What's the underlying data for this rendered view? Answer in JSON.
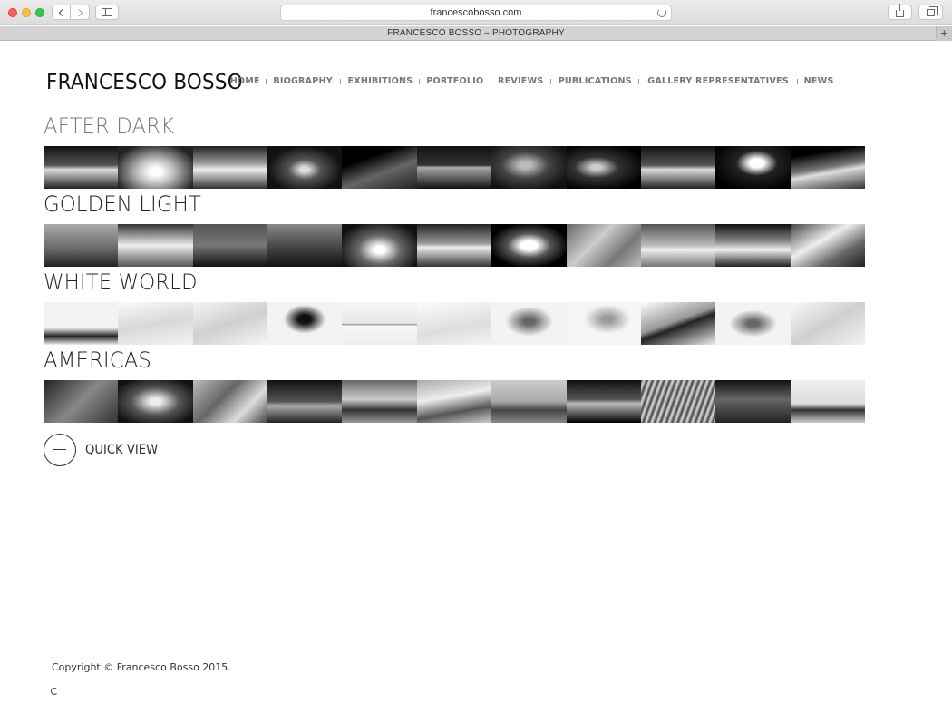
{
  "browser": {
    "url": "francescobosso.com",
    "tab_title": "FRANCESCO BOSSO – PHOTOGRAPHY",
    "new_tab_label": "+"
  },
  "site": {
    "brand": "FRANCESCO BOSSO",
    "nav": [
      {
        "label": "HOME"
      },
      {
        "label": "BIOGRAPHY"
      },
      {
        "label": "EXHIBITIONS"
      },
      {
        "label": "PORTFOLIO"
      },
      {
        "label": "REVIEWS"
      },
      {
        "label": "PUBLICATIONS"
      },
      {
        "label": "GALLERY REPRESENTATIVES"
      },
      {
        "label": "NEWS"
      }
    ]
  },
  "galleries": [
    {
      "title": "AFTER DARK",
      "thumbs": 11
    },
    {
      "title": "GOLDEN LIGHT",
      "thumbs": 11
    },
    {
      "title": "WHITE WORLD",
      "thumbs": 11
    },
    {
      "title": "AMERICAS",
      "thumbs": 11
    }
  ],
  "quick_view": {
    "label": "QUICK VIEW"
  },
  "footer": {
    "copyright": "Copyright © Francesco Bosso 2015."
  }
}
